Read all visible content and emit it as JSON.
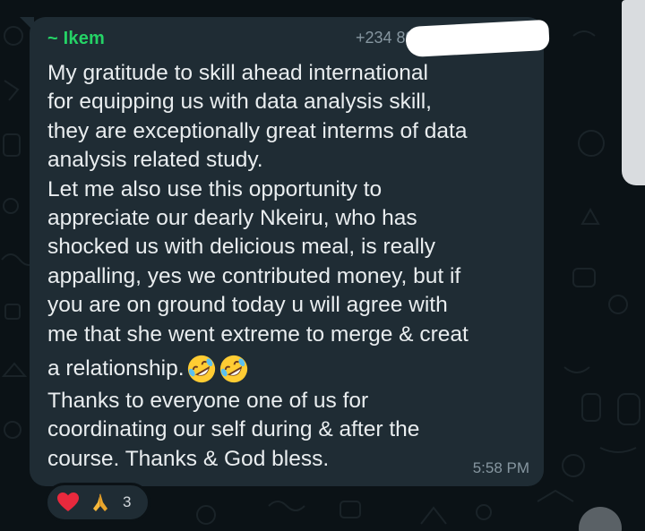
{
  "message": {
    "sender_name": "~ Ikem",
    "sender_phone": "+234 80",
    "paragraphs": [
      "My gratitude to skill ahead international",
      "for equipping us with data analysis skill,",
      "they are exceptionally great interms of data",
      "analysis related study.",
      "Let me also use this opportunity to",
      "appreciate our dearly Nkeiru, who has",
      "shocked us with delicious meal, is really",
      "appalling, yes we contributed money, but if",
      "you are on ground today u will agree with",
      "me that she went extreme to merge & creat"
    ],
    "emoji_line_text": "a relationship.",
    "emoji_line_emojis": [
      "rolling-on-floor-laughing-icon",
      "rolling-on-floor-laughing-icon"
    ],
    "closing_lines": [
      "Thanks to everyone one of us for",
      "coordinating our self during & after the",
      "course. Thanks & God bless."
    ],
    "timestamp": "5:58 PM"
  },
  "reactions": {
    "emojis": [
      "red-heart-icon",
      "folded-hands-icon"
    ],
    "count": "3"
  },
  "colors": {
    "background": "#0b1216",
    "bubble": "#1f2c34",
    "sender_name": "#25d366",
    "text": "#e9edef",
    "meta": "#8696a0"
  }
}
